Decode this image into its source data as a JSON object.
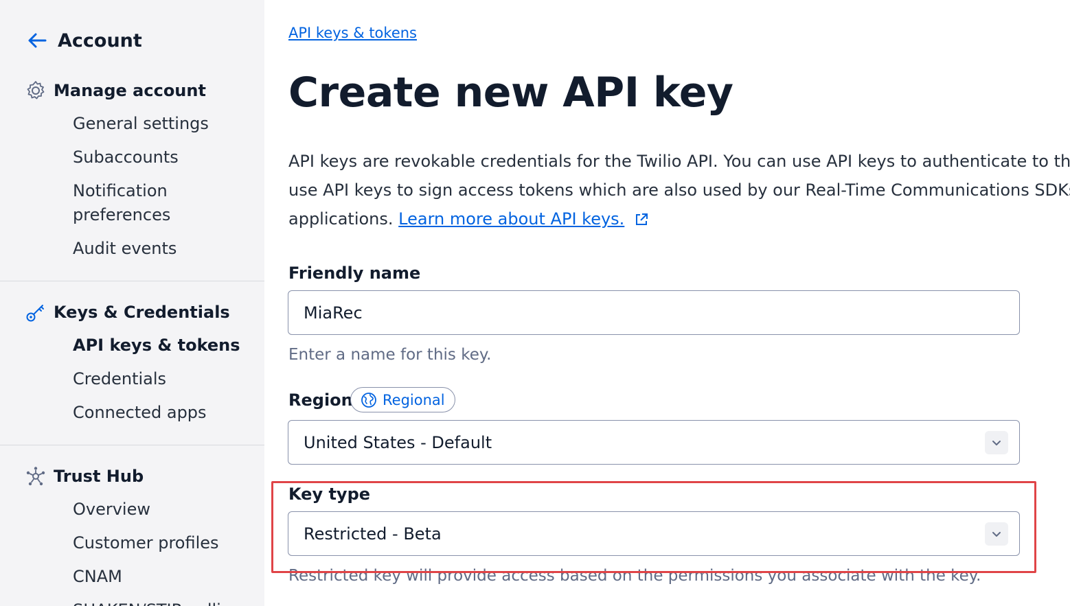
{
  "sidebar": {
    "back_label": "Account",
    "sections": [
      {
        "title": "Manage account",
        "icon": "gear-icon",
        "items": [
          "General settings",
          "Subaccounts",
          "Notification preferences",
          "Audit events"
        ]
      },
      {
        "title": "Keys & Credentials",
        "icon": "key-icon",
        "items": [
          "API keys & tokens",
          "Credentials",
          "Connected apps"
        ],
        "active": "API keys & tokens"
      },
      {
        "title": "Trust Hub",
        "icon": "hub-icon",
        "items": [
          "Overview",
          "Customer profiles",
          "CNAM",
          "SHAKEN/STIR calling"
        ]
      }
    ]
  },
  "main": {
    "breadcrumb": "API keys & tokens",
    "title": "Create new API key",
    "description": {
      "line1": "API keys are revokable credentials for the Twilio API. You can use API keys to authenticate to the REST API using basic auth or to",
      "line2": "use API keys to sign access tokens which are also used by our Real-Time Communications SDKs. Access tokens are short-lived credentials that can be distributed safely to client-side",
      "line3": "applications.",
      "link": "Learn more about API keys."
    },
    "friendly_name": {
      "label": "Friendly name",
      "value": "MiaRec",
      "help": "Enter a name for this key."
    },
    "region": {
      "label": "Region",
      "badge": "Regional",
      "value": "United States - Default"
    },
    "key_type": {
      "label": "Key type",
      "value": "Restricted - Beta",
      "help": "Restricted key will provide access based on the permissions you associate with the key."
    }
  },
  "colors": {
    "link": "#0263e0",
    "sidebar_bg": "#f4f4f6",
    "highlight": "#e04447"
  }
}
